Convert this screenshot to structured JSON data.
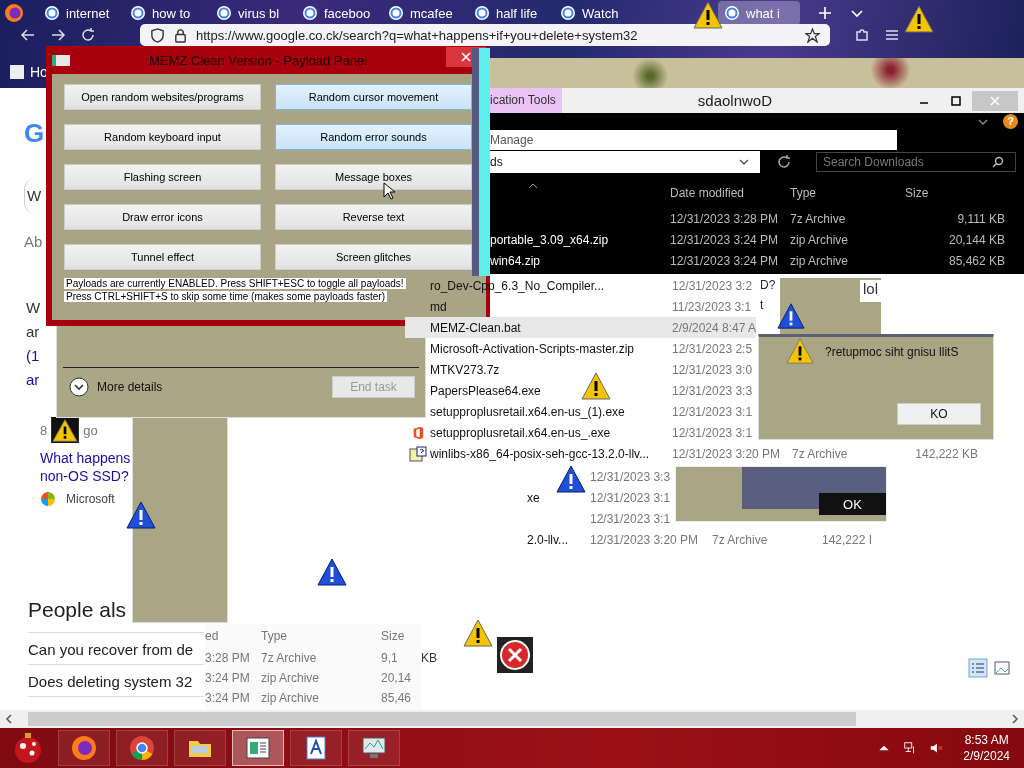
{
  "browser": {
    "tabs": [
      {
        "label": "internet",
        "selected": false
      },
      {
        "label": "how to",
        "selected": false
      },
      {
        "label": "virus bl",
        "selected": false
      },
      {
        "label": "faceboo",
        "selected": false
      },
      {
        "label": "mcafee",
        "selected": false
      },
      {
        "label": "half life",
        "selected": false
      },
      {
        "label": "Watch",
        "selected": false
      },
      {
        "label": "what i",
        "selected": true
      }
    ],
    "url": "https://www.google.co.ck/search?q=what+happens+if+you+delete+system32",
    "bookmark": "Ho"
  },
  "search_page": {
    "logo": "G",
    "fragments": [
      "W",
      "Ab",
      "W",
      "ar",
      "(1",
      "ar"
    ],
    "age": "8",
    "age_tail": "go",
    "result_link": "What happens non-OS SSD?",
    "source": "Microsoft",
    "people_also": "People als",
    "questions": [
      "Can you recover from de",
      "Does deleting system 32"
    ]
  },
  "payload_panel": {
    "title": "MEMZ Clean Version - Payload Panel",
    "buttons": [
      {
        "label": "Open random websites/programs",
        "selected": false
      },
      {
        "label": "Random cursor movement",
        "selected": true
      },
      {
        "label": "Random keyboard input",
        "selected": false
      },
      {
        "label": "Random error sounds",
        "selected": true
      },
      {
        "label": "Flashing screen",
        "selected": false
      },
      {
        "label": "Message boxes",
        "selected": false
      },
      {
        "label": "Draw error icons",
        "selected": false
      },
      {
        "label": "Reverse text",
        "selected": false
      },
      {
        "label": "Tunnel effect",
        "selected": false
      },
      {
        "label": "Screen glitches",
        "selected": false
      }
    ],
    "notices": [
      "Payloads are currently ENABLED. Press SHIFT+ESC to toggle all payloads!",
      "Press CTRL+SHIFT+S to skip some time (makes some payloads faster)"
    ]
  },
  "task_manager": {
    "more_details": "More details",
    "end_task": {
      "label": "End task",
      "disabled": true
    }
  },
  "explorer": {
    "tab": "ication Tools",
    "title": "sdaolnwoD",
    "help": "?",
    "ribbon_tab": "Manage",
    "address": "ds",
    "search": {
      "placeholder": "Search Downloads"
    },
    "columns": [
      "Date modified",
      "Type",
      "Size"
    ],
    "dark_rows": [
      {
        "name": "",
        "date": "12/31/2023 3:28 PM",
        "type": "7z Archive",
        "size": "9,111 KB"
      },
      {
        "name": "portable_3.09_x64.zip",
        "date": "12/31/2023 3:24 PM",
        "type": "zip Archive",
        "size": "20,144 KB"
      },
      {
        "name": "win64.zip",
        "date": "12/31/2023 3:24 PM",
        "type": "zip Archive",
        "size": "85,462 KB"
      }
    ],
    "rows": [
      {
        "kind": "plain",
        "name": "ro_Dev-Cpp_6.3_No_Compiler...",
        "date": "12/31/2023 3:2",
        "type": "",
        "size": "",
        "selected": false
      },
      {
        "kind": "plain",
        "name": "md",
        "date": "11/23/2023 3:1",
        "type": "",
        "size": "",
        "selected": false
      },
      {
        "kind": "plain",
        "name": "MEMZ-Clean.bat",
        "date": "2/9/2024 8:47 A",
        "type": "",
        "size": "",
        "selected": true
      },
      {
        "kind": "plain",
        "name": "Microsoft-Activation-Scripts-master.zip",
        "date": "12/31/2023 2:5",
        "type": "",
        "size": "",
        "selected": false
      },
      {
        "kind": "plain",
        "name": "MTKV273.7z",
        "date": "12/31/2023 3:0",
        "type": "",
        "size": "",
        "selected": false
      },
      {
        "kind": "plain",
        "name": "PapersPlease64.exe",
        "date": "12/31/2023 3:3",
        "type": "",
        "size": "",
        "selected": false
      },
      {
        "kind": "plain",
        "name": "setupproplusretail.x64.en-us_(1).exe",
        "date": "12/31/2023 3:1",
        "type": "",
        "size": "",
        "selected": false
      },
      {
        "kind": "office",
        "name": "setupproplusretail.x64.en-us_.exe",
        "date": "12/31/2023 3:1",
        "type": "",
        "size": "",
        "selected": false
      },
      {
        "kind": "installer",
        "name": "winlibs-x86_64-posix-seh-gcc-13.2.0-llv...",
        "date": "12/31/2023 3:20 PM",
        "type": "7z Archive",
        "size": "142,222 KB",
        "selected": false
      }
    ],
    "ghost_rows": [
      {
        "name": "",
        "date": "12/31/2023 3:3",
        "type": "",
        "size": ""
      },
      {
        "name": "xe",
        "date": "12/31/2023 3:1",
        "type": "",
        "size": ""
      },
      {
        "name": "",
        "date": "12/31/2023 3:1",
        "type": "",
        "size": ""
      },
      {
        "name": "2.0-llv...",
        "date": "12/31/2023 3:20 PM",
        "type": "7z Archive",
        "size": "142,222 I"
      }
    ],
    "lower_table": {
      "columns": [
        "ed",
        "Type",
        "Size"
      ],
      "rows": [
        {
          "time": "3:28 PM",
          "type": "7z Archive",
          "size": "9,1",
          "tail": "KB"
        },
        {
          "time": "3:24 PM",
          "type": "zip Archive",
          "size": "20,14",
          "tail": ""
        },
        {
          "time": "3:24 PM",
          "type": "zip Archive",
          "size": "85,46",
          "tail": ""
        }
      ]
    }
  },
  "dialogs": {
    "question": "D?",
    "fragment": "t",
    "lol": "lol",
    "message": "?retupmoc siht gnisu llitS",
    "ko": "KO",
    "ok": "OK"
  },
  "taskbar": {
    "apps": [
      {
        "kind": "firefox",
        "selected": false
      },
      {
        "kind": "chrome",
        "selected": false
      },
      {
        "kind": "folder",
        "selected": false
      },
      {
        "kind": "document",
        "selected": true
      },
      {
        "kind": "wordpad",
        "selected": false
      },
      {
        "kind": "monitor",
        "selected": false
      }
    ],
    "time": "8:53 AM",
    "date": "2/9/2024"
  }
}
